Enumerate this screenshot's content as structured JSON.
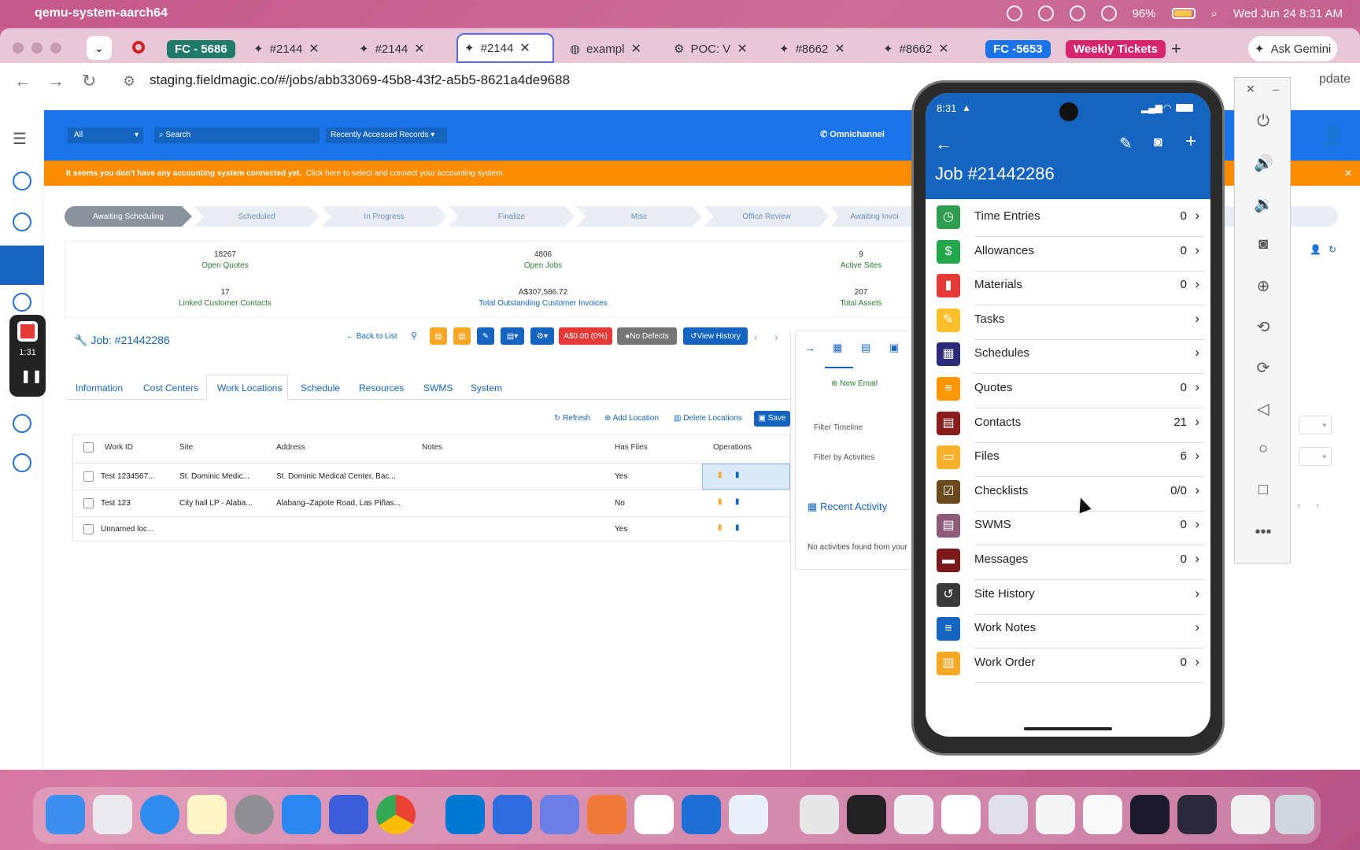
{
  "menubar": {
    "app": "qemu-system-aarch64",
    "battery": "96%",
    "datetime": "Wed Jun 24  8:31 AM"
  },
  "tabs": [
    {
      "label": "FC - 5686",
      "color": "#1f7a6a",
      "type": "pill"
    },
    {
      "label": "#2144",
      "type": "tab"
    },
    {
      "label": "#2144",
      "type": "tab"
    },
    {
      "label": "#2144",
      "type": "active"
    },
    {
      "label": "exampl",
      "type": "tab"
    },
    {
      "label": "POC: V",
      "type": "tab"
    },
    {
      "label": "#8662",
      "type": "tab"
    },
    {
      "label": "#8662",
      "type": "tab"
    },
    {
      "label": "FC -5653",
      "color": "#1a73e8",
      "type": "pill"
    },
    {
      "label": "Weekly Tickets",
      "color": "#d6246e",
      "type": "pill"
    }
  ],
  "browser": {
    "url": "staging.fieldmagic.co/#/jobs/abb33069-45b8-43f2-a5b5-8621a4de9688",
    "ask_gemini": "Ask Gemini",
    "update": "pdate"
  },
  "appheader": {
    "filter": "All",
    "search_placeholder": "Search",
    "recent": "Recently Accessed Records",
    "omnichannel": "Omnichannel"
  },
  "alert": {
    "text": "It seems you don't have any accounting system connected yet.",
    "link": "Click here to select and connect your accounting system."
  },
  "steps": [
    "Awaiting Scheduling",
    "Scheduled",
    "In Progress",
    "Finalize",
    "Misc",
    "Office Review",
    "Awaiting Invoi"
  ],
  "stats": [
    {
      "value": "18267",
      "label": "Open Quotes"
    },
    {
      "value": "4806",
      "label": "Open Jobs"
    },
    {
      "value": "9",
      "label": "Active Sites"
    },
    {
      "value": "17",
      "label": "Linked Customer Contacts"
    },
    {
      "value": "A$307,586.72",
      "label": "Total Outstanding Customer Invoices"
    },
    {
      "value": "207",
      "label": "Total Assets"
    }
  ],
  "job": {
    "title": "Job: #21442286",
    "back": "Back to List",
    "amount": "A$0.00 (0%)",
    "defects": "No Defects",
    "history": "View History"
  },
  "page_tabs": [
    "Information",
    "Cost Centers",
    "Work Locations",
    "Schedule",
    "Resources",
    "SWMS",
    "System"
  ],
  "table_actions": {
    "refresh": "Refresh",
    "add": "Add Location",
    "delete": "Delete Locations",
    "save": "Save"
  },
  "table": {
    "headers": [
      "Work ID",
      "Site",
      "Address",
      "Notes",
      "Has Files",
      "Operations"
    ],
    "rows": [
      {
        "work_id": "Test 1234567...",
        "site": "St. Dominic Medic...",
        "address": "St. Dominic Medical Center, Bac...",
        "files": "Yes"
      },
      {
        "work_id": "Test 123",
        "site": "City hall LP - Alaba...",
        "address": "Alabang–Zapote Road, Las Piñas...",
        "files": "No"
      },
      {
        "work_id": "Unnamed loc...",
        "site": "",
        "address": "",
        "files": "Yes"
      }
    ]
  },
  "right_panel": {
    "new_email": "New Email",
    "filter_timeline": "Filter Timeline",
    "filter_activities": "Filter by Activities",
    "recent": "Recent Activity",
    "empty": "No activities found from your"
  },
  "rec_timer": "1:31",
  "phone": {
    "time": "8:31",
    "title": "Job #21442286",
    "items": [
      {
        "label": "Time Entries",
        "count": "0",
        "color": "#2e9e4e",
        "icon": "clock-icon"
      },
      {
        "label": "Allowances",
        "count": "0",
        "color": "#22a84a",
        "icon": "dollar-icon"
      },
      {
        "label": "Materials",
        "count": "0",
        "color": "#e53935",
        "icon": "box-icon"
      },
      {
        "label": "Tasks",
        "count": "",
        "color": "#f9c02c",
        "icon": "task-icon"
      },
      {
        "label": "Schedules",
        "count": "",
        "color": "#2b2a7a",
        "icon": "calendar-icon"
      },
      {
        "label": "Quotes",
        "count": "0",
        "color": "#ff9800",
        "icon": "list-icon"
      },
      {
        "label": "Contacts",
        "count": "21",
        "color": "#8b1c1c",
        "icon": "contact-icon"
      },
      {
        "label": "Files",
        "count": "6",
        "color": "#fbb02d",
        "icon": "folder-icon"
      },
      {
        "label": "Checklists",
        "count": "0/0",
        "color": "#6b4a1e",
        "icon": "checklist-icon"
      },
      {
        "label": "SWMS",
        "count": "0",
        "color": "#8e5a7a",
        "icon": "doc-icon"
      },
      {
        "label": "Messages",
        "count": "0",
        "color": "#7a1a1a",
        "icon": "message-icon"
      },
      {
        "label": "Site History",
        "count": "",
        "color": "#3a3a3a",
        "icon": "history-icon"
      },
      {
        "label": "Work Notes",
        "count": "",
        "color": "#1565c0",
        "icon": "notes-icon"
      },
      {
        "label": "Work Order",
        "count": "0",
        "color": "#f9a825",
        "icon": "order-icon"
      }
    ]
  }
}
